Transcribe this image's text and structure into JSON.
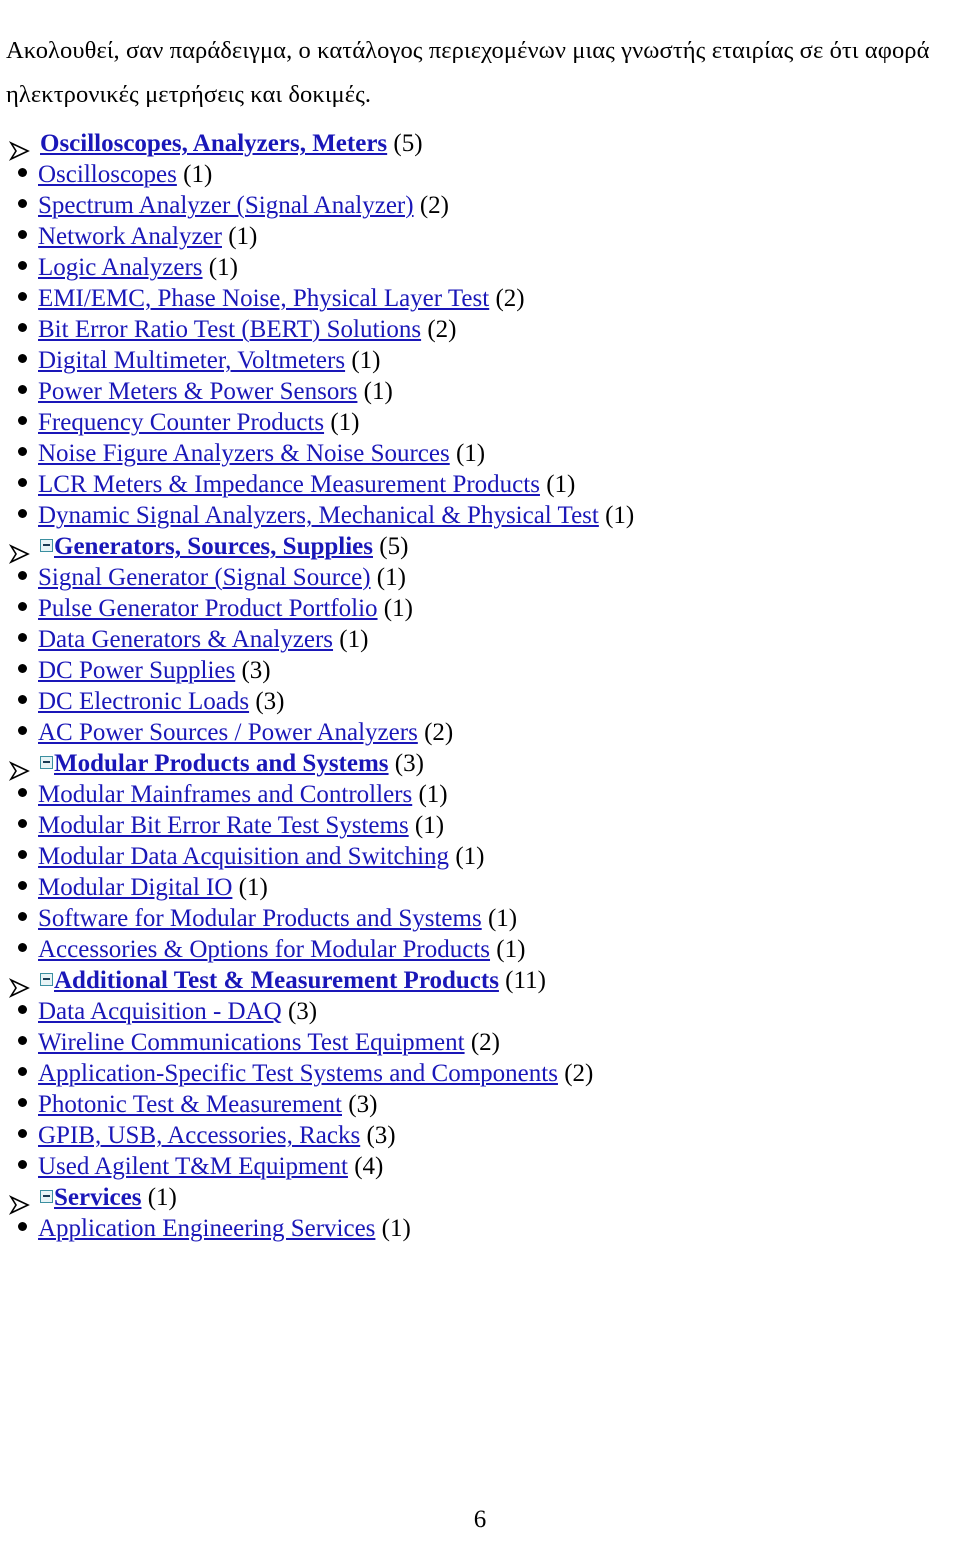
{
  "document": {
    "page_number": "6",
    "intro_paragraph": "Ακολουθεί, σαν παράδειγμα, ο κατάλογος περιεχομένων μιας γνωστής εταιρίας σε ότι αφορά ηλεκτρονικές μετρήσεις και δοκιμές.",
    "link_color": "#1a17b8",
    "text_color": "#000000",
    "background_color": "#ffffff",
    "collapse_icon_border_color": "#3b8fa0",
    "collapse_icon_fill_color": "#e8f4f6"
  },
  "outline": {
    "rows": [
      {
        "level": "head",
        "marker": "arrow-bullet",
        "collapse_icon": false,
        "label": "Oscilloscopes, Analyzers, Meters",
        "count": "(5)"
      },
      {
        "level": "item",
        "marker": "disc-bullet",
        "collapse_icon": false,
        "label": "Oscilloscopes",
        "count": "(1)"
      },
      {
        "level": "item",
        "marker": "disc-bullet",
        "collapse_icon": false,
        "label": "Spectrum Analyzer (Signal Analyzer)",
        "count": "(2)"
      },
      {
        "level": "item",
        "marker": "disc-bullet",
        "collapse_icon": false,
        "label": "Network Analyzer",
        "count": "(1)"
      },
      {
        "level": "item",
        "marker": "disc-bullet",
        "collapse_icon": false,
        "label": "Logic Analyzers",
        "count": "(1)"
      },
      {
        "level": "item",
        "marker": "disc-bullet",
        "collapse_icon": false,
        "label": "EMI/EMC, Phase Noise, Physical Layer Test",
        "count": "(2)"
      },
      {
        "level": "item",
        "marker": "disc-bullet",
        "collapse_icon": false,
        "label": "Bit Error Ratio Test (BERT) Solutions",
        "count": "(2)"
      },
      {
        "level": "item",
        "marker": "disc-bullet",
        "collapse_icon": false,
        "label": "Digital Multimeter, Voltmeters",
        "count": "(1)"
      },
      {
        "level": "item",
        "marker": "disc-bullet",
        "collapse_icon": false,
        "label": "Power Meters & Power Sensors",
        "count": "(1)"
      },
      {
        "level": "item",
        "marker": "disc-bullet",
        "collapse_icon": false,
        "label": "Frequency Counter Products",
        "count": "(1)"
      },
      {
        "level": "item",
        "marker": "disc-bullet",
        "collapse_icon": false,
        "label": "Noise Figure Analyzers & Noise Sources",
        "count": "(1)"
      },
      {
        "level": "item",
        "marker": "disc-bullet",
        "collapse_icon": false,
        "label": "LCR Meters & Impedance Measurement Products",
        "count": "(1)"
      },
      {
        "level": "item",
        "marker": "disc-bullet",
        "collapse_icon": false,
        "label": "Dynamic Signal Analyzers, Mechanical & Physical Test",
        "count": "(1)"
      },
      {
        "level": "head",
        "marker": "arrow-bullet",
        "collapse_icon": true,
        "label": "Generators, Sources, Supplies",
        "count": "(5)"
      },
      {
        "level": "item",
        "marker": "disc-bullet",
        "collapse_icon": false,
        "label": "Signal Generator (Signal Source)",
        "count": "(1)"
      },
      {
        "level": "item",
        "marker": "disc-bullet",
        "collapse_icon": false,
        "label": "Pulse Generator Product Portfolio",
        "count": "(1)"
      },
      {
        "level": "item",
        "marker": "disc-bullet",
        "collapse_icon": false,
        "label": "Data Generators & Analyzers",
        "count": "(1)"
      },
      {
        "level": "item",
        "marker": "disc-bullet",
        "collapse_icon": false,
        "label": "DC Power Supplies",
        "count": "(3)"
      },
      {
        "level": "item",
        "marker": "disc-bullet",
        "collapse_icon": false,
        "label": "DC Electronic Loads",
        "count": "(3)"
      },
      {
        "level": "item",
        "marker": "disc-bullet",
        "collapse_icon": false,
        "label": "AC Power Sources / Power Analyzers",
        "count": "(2)"
      },
      {
        "level": "head",
        "marker": "arrow-bullet",
        "collapse_icon": true,
        "label": "Modular Products and Systems",
        "count": "(3)"
      },
      {
        "level": "item",
        "marker": "disc-bullet",
        "collapse_icon": false,
        "label": "Modular Mainframes and Controllers",
        "count": "(1)"
      },
      {
        "level": "item",
        "marker": "disc-bullet",
        "collapse_icon": false,
        "label": "Modular Bit Error Rate Test Systems",
        "count": "(1)"
      },
      {
        "level": "item",
        "marker": "disc-bullet",
        "collapse_icon": false,
        "label": "Modular Data Acquisition and Switching",
        "count": "(1)"
      },
      {
        "level": "item",
        "marker": "disc-bullet",
        "collapse_icon": false,
        "label": "Modular Digital IO",
        "count": "(1)"
      },
      {
        "level": "item",
        "marker": "disc-bullet",
        "collapse_icon": false,
        "label": "Software for Modular Products and Systems",
        "count": "(1)"
      },
      {
        "level": "item",
        "marker": "disc-bullet",
        "collapse_icon": false,
        "label": "Accessories & Options for Modular Products",
        "count": "(1)"
      },
      {
        "level": "head",
        "marker": "arrow-bullet",
        "collapse_icon": true,
        "label": "Additional Test & Measurement Products",
        "count": "(11)"
      },
      {
        "level": "item",
        "marker": "disc-bullet",
        "collapse_icon": false,
        "label": "Data Acquisition - DAQ",
        "count": "(3)"
      },
      {
        "level": "item",
        "marker": "disc-bullet",
        "collapse_icon": false,
        "label": "Wireline Communications Test Equipment",
        "count": "(2)"
      },
      {
        "level": "item",
        "marker": "disc-bullet",
        "collapse_icon": false,
        "label": "Application-Specific Test Systems and Components",
        "count": "(2)"
      },
      {
        "level": "item",
        "marker": "disc-bullet",
        "collapse_icon": false,
        "label": "Photonic Test & Measurement",
        "count": "(3)"
      },
      {
        "level": "item",
        "marker": "disc-bullet",
        "collapse_icon": false,
        "label": "GPIB, USB, Accessories, Racks",
        "count": "(3)"
      },
      {
        "level": "item",
        "marker": "disc-bullet",
        "collapse_icon": false,
        "label": "Used Agilent T&M Equipment",
        "count": "(4)"
      },
      {
        "level": "head",
        "marker": "arrow-bullet",
        "collapse_icon": true,
        "label": "Services",
        "count": "(1)"
      },
      {
        "level": "item",
        "marker": "disc-bullet",
        "collapse_icon": false,
        "label": "Application Engineering Services",
        "count": "(1)"
      }
    ]
  }
}
